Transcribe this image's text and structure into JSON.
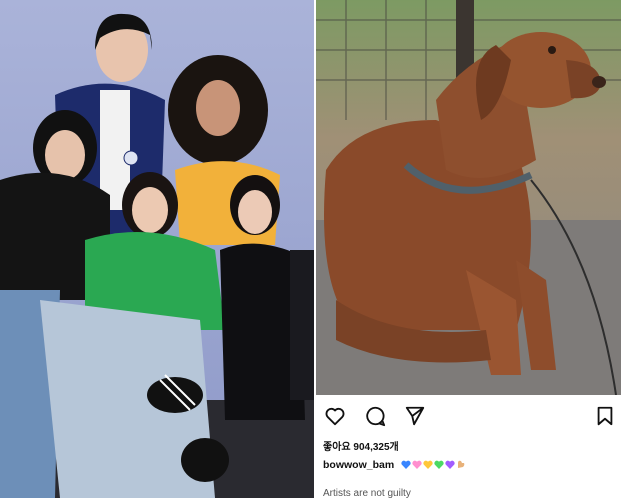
{
  "post": {
    "likes_text": "좋아요 904,325개",
    "username": "bowwow_bam",
    "hearts": [
      "#3a86ff",
      "#ff8fcf",
      "#ffc73a",
      "#4cd964",
      "#a15cff"
    ],
    "cut_text": "Artists are not guilty"
  },
  "icons": {
    "like": "heart-outline-icon",
    "comment": "comment-bubble-icon",
    "share": "paper-plane-icon",
    "save": "bookmark-icon",
    "emoji": "flexed-biceps-icon"
  }
}
